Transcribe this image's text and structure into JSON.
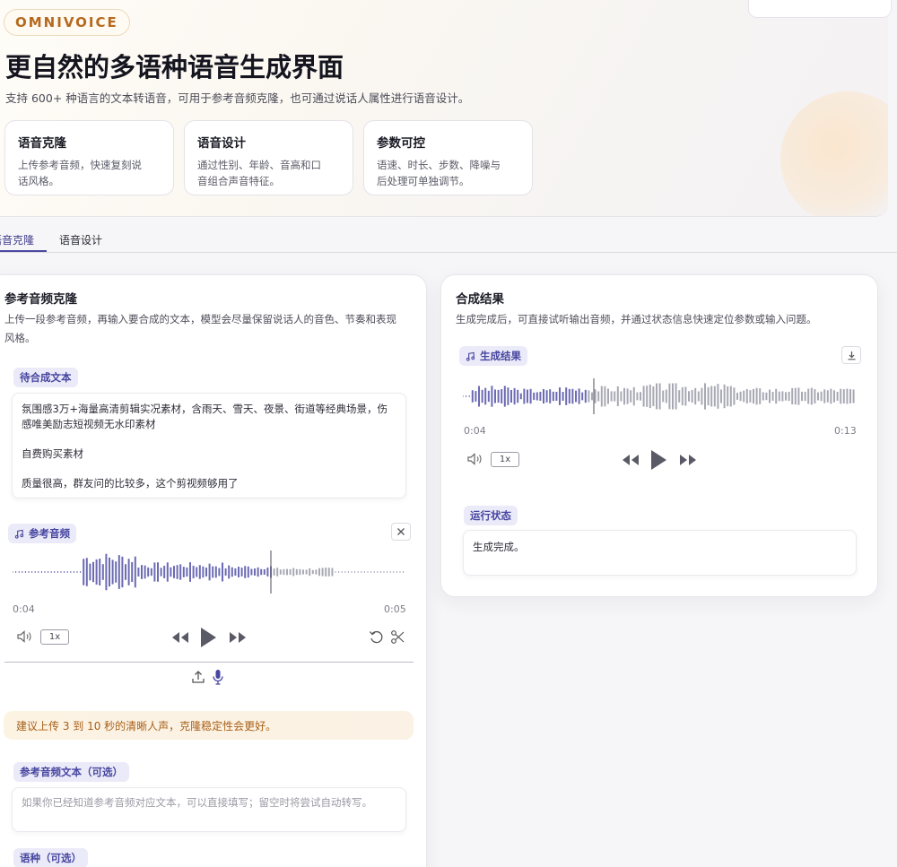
{
  "hero": {
    "brand": "OMNIVOICE",
    "title": "更自然的多语种语音生成界面",
    "subtitle": "支持 600+ 种语言的文本转语音，可用于参考音频克隆，也可通过说话人属性进行语音设计。",
    "features": [
      {
        "title": "语音克隆",
        "desc_line1": "上传参考音频，快速复刻说",
        "desc_line2": "话风格。"
      },
      {
        "title": "语音设计",
        "desc_line1": "通过性别、年龄、音高和口",
        "desc_line2": "音组合声音特征。"
      },
      {
        "title": "参数可控",
        "desc_line1": "语速、时长、步数、降噪与",
        "desc_line2": "后处理可单独调节。"
      }
    ]
  },
  "tabs": [
    {
      "label": "语音克隆",
      "active": true
    },
    {
      "label": "语音设计",
      "active": false
    }
  ],
  "clone": {
    "title": "参考音频克隆",
    "desc_line1": "上传一段参考音频，再输入要合成的文本，模型会尽量保留说话人的音色、节奏和表现",
    "desc_line2": "风格。",
    "text_label": "待合成文本",
    "text_lines": [
      "氛围感3万+海量高清剪辑实况素材，含雨天、雪天、夜景、街道等经典场景，伤",
      "感唯美励志短视频无水印素材",
      "自费购买素材",
      "质量很高，群友问的比较多，这个剪视频够用了"
    ],
    "audio_label": "参考音频",
    "audio_time_current": "0:04",
    "audio_time_total": "0:05",
    "speed": "1x",
    "tip": "建议上传 3 到 10 秒的清晰人声，克隆稳定性会更好。",
    "ref_text_label": "参考音频文本（可选）",
    "ref_text_placeholder": "如果你已经知道参考音频对应文本，可以直接填写；留空时将尝试自动转写。",
    "seed_label": "语种（可选）"
  },
  "result": {
    "title": "合成结果",
    "desc": "生成完成后，可直接试听输出音频，并通过状态信息快速定位参数或输入问题。",
    "audio_label": "生成结果",
    "time_current": "0:04",
    "time_total": "0:13",
    "speed": "1x",
    "status_label": "运行状态",
    "status_text": "生成完成。"
  },
  "colors": {
    "accent": "#4746a0",
    "pill_bg": "#ebeaf8",
    "brand": "#b56a1e",
    "tip_text": "#a86018",
    "wave": "#6b6ab4"
  }
}
